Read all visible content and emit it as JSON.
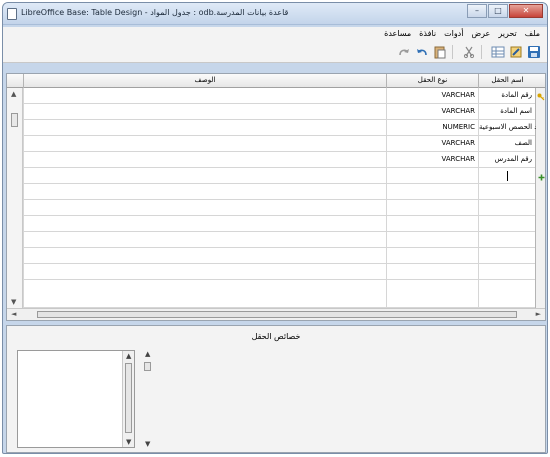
{
  "window": {
    "title": "قاعدة بيانات المدرسة.odb : جدول المواد - LibreOffice Base: Table Design",
    "min_label": "–",
    "max_label": "□",
    "close_label": "✕"
  },
  "menu": [
    "ملف",
    "تحرير",
    "عرض",
    "أدوات",
    "نافذة",
    "مساعدة"
  ],
  "grid": {
    "headers": {
      "name": "اسم الحقل",
      "type": "نوع الحقل",
      "description": "الوصف"
    },
    "rows": [
      {
        "name": "رقم المادة",
        "type": "VARCHAR",
        "key": true
      },
      {
        "name": "اسم المادة",
        "type": "VARCHAR",
        "key": false
      },
      {
        "name": "عدد الحصص الاسبوعية",
        "type": "NUMERIC",
        "key": false
      },
      {
        "name": "الصف",
        "type": "VARCHAR",
        "key": false
      },
      {
        "name": "رقم المدرس",
        "type": "VARCHAR",
        "key": false
      }
    ]
  },
  "properties": {
    "title": "خصائص الحقل"
  },
  "colors": {
    "accent": "#2f6fb5",
    "key": "#d9a400",
    "new_row": "#3a8f2a"
  }
}
